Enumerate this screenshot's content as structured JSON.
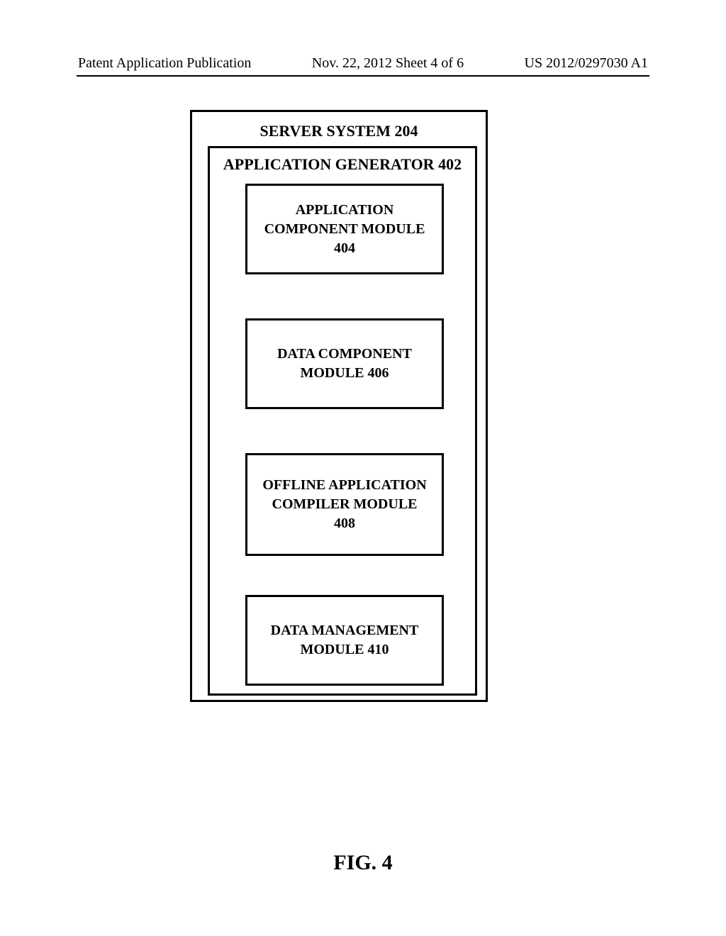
{
  "header": {
    "publication_label": "Patent Application Publication",
    "date_sheet": "Nov. 22, 2012  Sheet 4 of 6",
    "publication_number": "US 2012/0297030 A1"
  },
  "diagram": {
    "outer_title": "SERVER SYSTEM 204",
    "inner_title": "APPLICATION GENERATOR 402",
    "modules": {
      "m1": {
        "line1": "APPLICATION",
        "line2": "COMPONENT MODULE",
        "line3": "404"
      },
      "m2": {
        "line1": "DATA COMPONENT",
        "line2": "MODULE 406"
      },
      "m3": {
        "line1": "OFFLINE APPLICATION",
        "line2": "COMPILER MODULE",
        "line3": "408"
      },
      "m4": {
        "line1": "DATA MANAGEMENT",
        "line2": "MODULE 410"
      }
    }
  },
  "figure_caption": "FIG. 4"
}
